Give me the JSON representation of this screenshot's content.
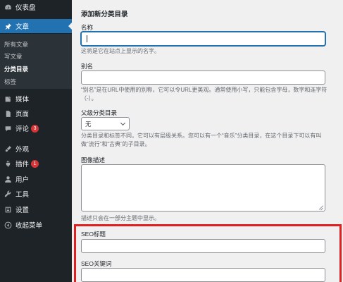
{
  "sidebar": {
    "items": [
      {
        "label": "仪表盘",
        "icon": "dashboard-icon"
      },
      {
        "label": "文章",
        "icon": "pin-icon"
      },
      {
        "label": "媒体",
        "icon": "media-icon"
      },
      {
        "label": "页面",
        "icon": "page-icon"
      },
      {
        "label": "评论",
        "icon": "comment-icon",
        "badge": "3"
      },
      {
        "label": "外观",
        "icon": "appearance-icon"
      },
      {
        "label": "插件",
        "icon": "plugin-icon",
        "badge": "1"
      },
      {
        "label": "用户",
        "icon": "user-icon"
      },
      {
        "label": "工具",
        "icon": "wrench-icon"
      },
      {
        "label": "设置",
        "icon": "settings-icon"
      },
      {
        "label": "收起菜单",
        "icon": "collapse-icon"
      }
    ],
    "submenu": [
      "所有文章",
      "写文章",
      "分类目录",
      "标签"
    ]
  },
  "form": {
    "title": "添加新分类目录",
    "name_label": "名称",
    "name_value": "",
    "name_desc": "这将是它在站点上显示的名字。",
    "slug_label": "别名",
    "slug_value": "",
    "slug_desc": "“别名”是在URL中使用的别称，它可以令URL更美观。通常使用小写，只能包含字母，数字和连字符（-）。",
    "parent_label": "父级分类目录",
    "parent_value": "无",
    "parent_desc": "分类目录和标签不同，它可以有层级关系。您可以有一个“音乐”分类目录，在这个目录下可以有叫做“流行”和“古典”的子目录。",
    "image_label": "图像描述",
    "image_desc": "描述只会在一部分主题中显示。",
    "seo_title_label": "SEO标题",
    "seo_title_value": "",
    "seo_keywords_label": "SEO关键词",
    "seo_keywords_value": ""
  },
  "colors": {
    "sidebar_bg": "#1d2327",
    "accent": "#2271b1",
    "badge": "#d63638",
    "highlight": "#e02020"
  }
}
